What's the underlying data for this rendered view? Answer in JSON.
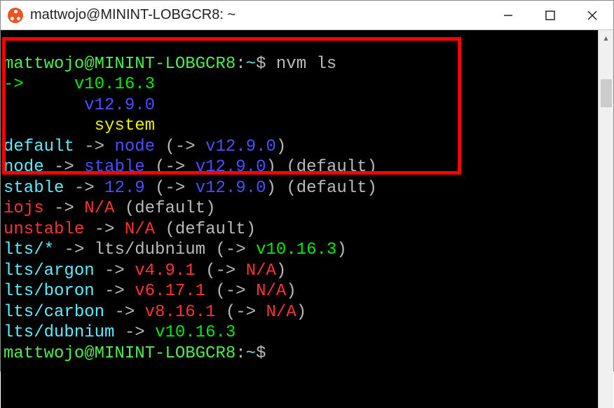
{
  "titlebar": {
    "title": "mattwojo@MININT-LOBGCR8: ~"
  },
  "terminal": {
    "prompt_user": "mattwojo@MININT-LOBGCR8",
    "prompt_sep": ":",
    "prompt_path": "~",
    "prompt_end": "$",
    "command": "nvm ls",
    "lines": {
      "arrow": "->",
      "v10": "v10.16.3",
      "v12": "v12.9.0",
      "system": "system",
      "default": "default",
      "arrow2": "->",
      "node": "node",
      "open": "(",
      "close": ")",
      "default_lbl": "(default)",
      "stable": "stable",
      "v12_9": "12.9",
      "iojs": "iojs",
      "na": "N/A",
      "unstable": "unstable",
      "lts_star": "lts/*",
      "lts_dubnium": "lts/dubnium",
      "lts_argon": "lts/argon",
      "v4": "v4.9.1",
      "lts_boron": "lts/boron",
      "v6": "v6.17.1",
      "lts_carbon": "lts/carbon",
      "v8": "v8.16.1"
    }
  }
}
